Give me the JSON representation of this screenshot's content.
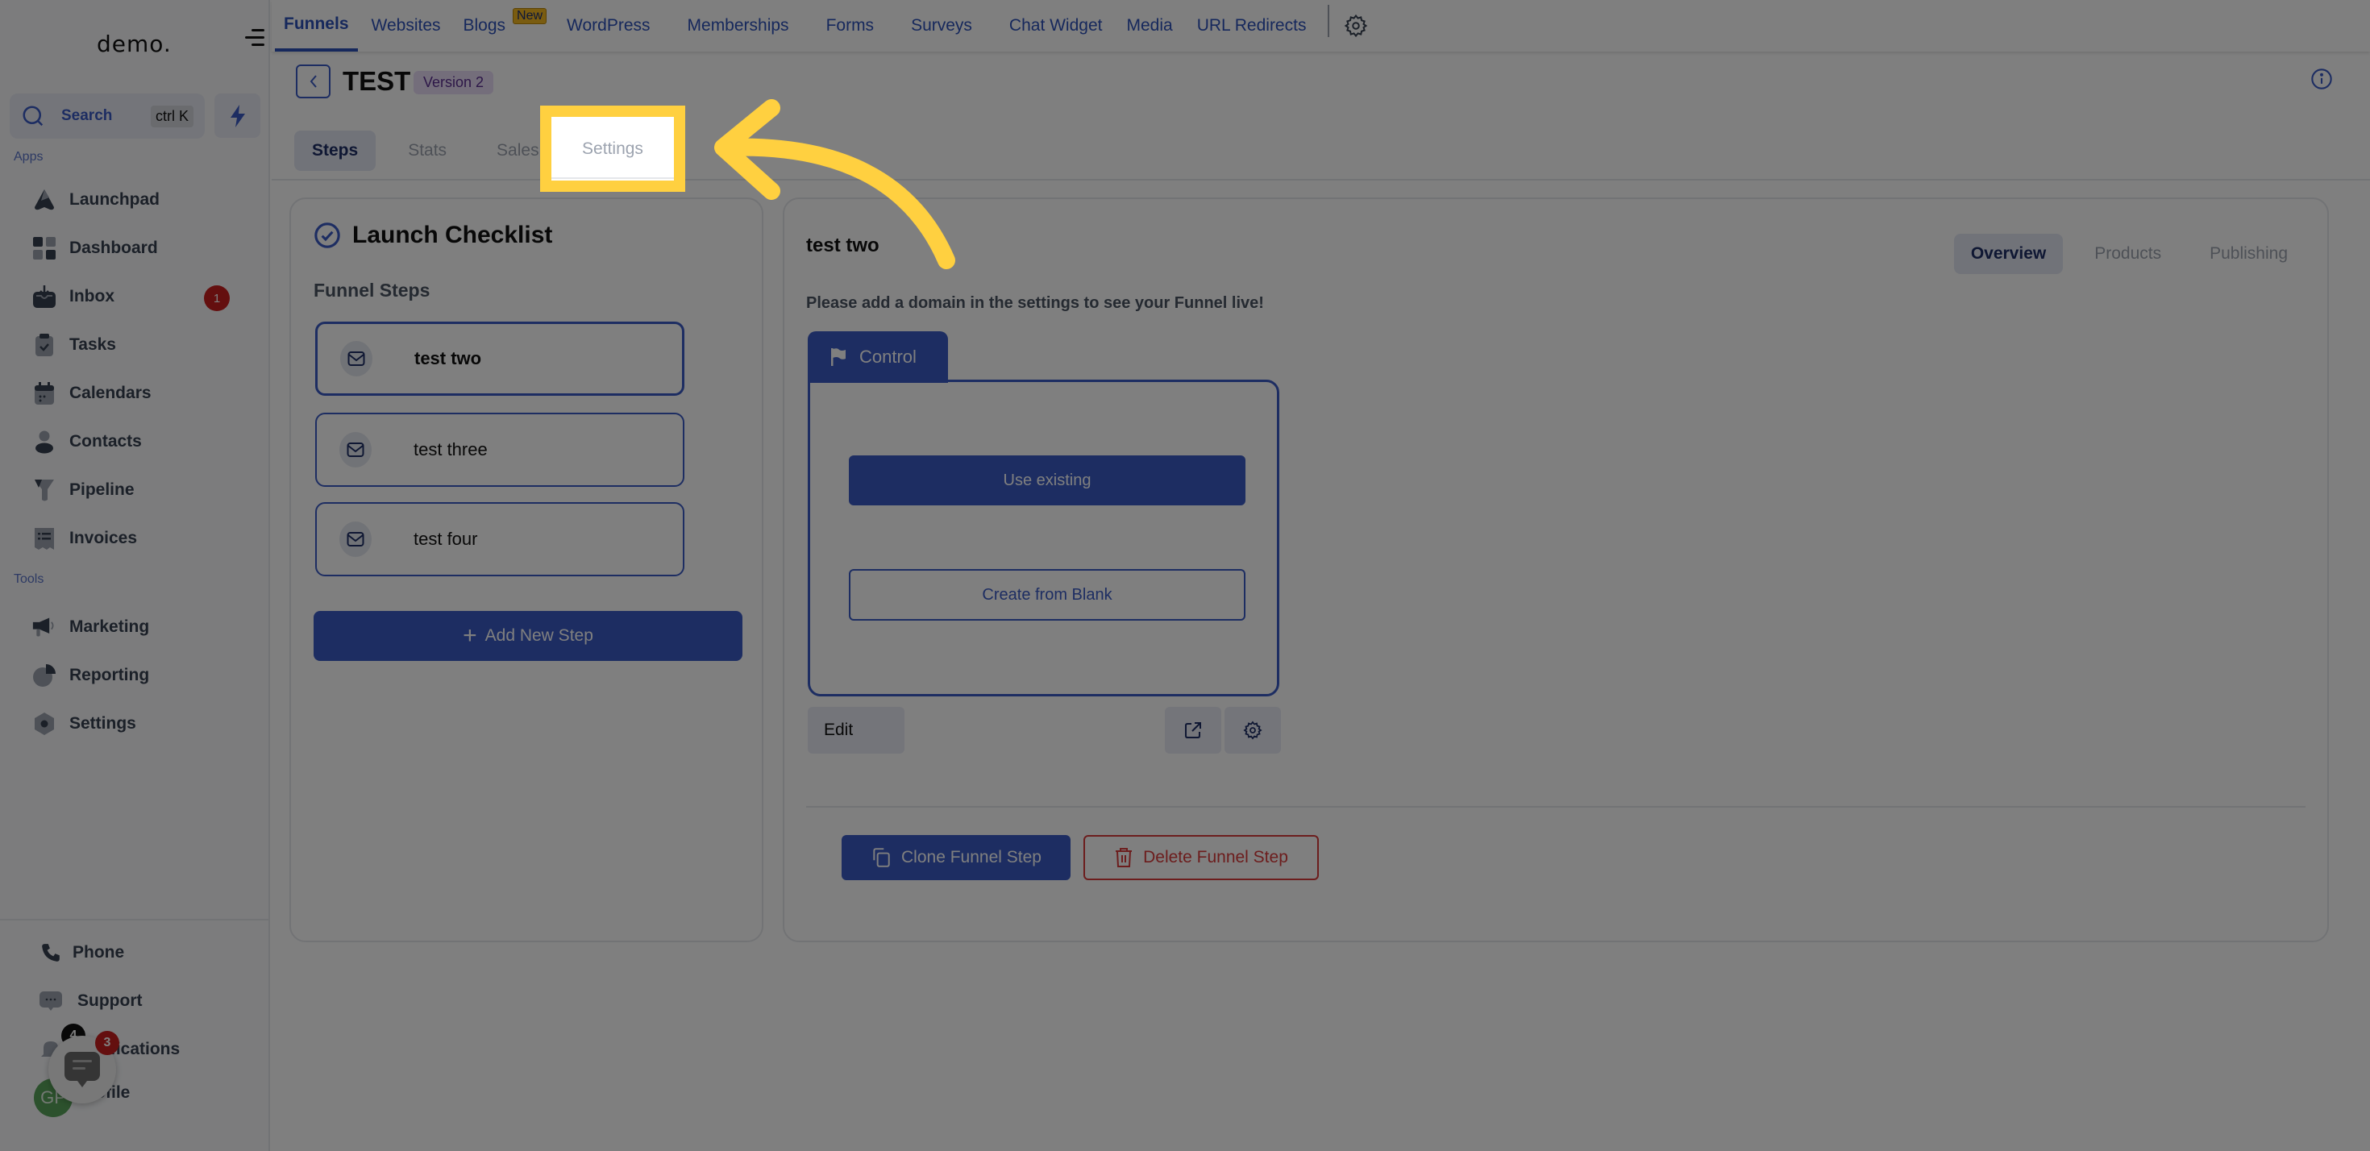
{
  "sidebar": {
    "logo": "demo.",
    "search": {
      "label": "Search",
      "shortcut": "ctrl K"
    },
    "sections": {
      "apps": "Apps",
      "tools": "Tools"
    },
    "apps_items": [
      {
        "label": "Launchpad",
        "icon": "launchpad-icon"
      },
      {
        "label": "Dashboard",
        "icon": "dashboard-icon"
      },
      {
        "label": "Inbox",
        "icon": "inbox-icon",
        "badge": "1"
      },
      {
        "label": "Tasks",
        "icon": "tasks-icon"
      },
      {
        "label": "Calendars",
        "icon": "calendar-icon"
      },
      {
        "label": "Contacts",
        "icon": "contacts-icon"
      },
      {
        "label": "Pipeline",
        "icon": "pipeline-icon"
      },
      {
        "label": "Invoices",
        "icon": "invoices-icon"
      }
    ],
    "tools_items": [
      {
        "label": "Marketing",
        "icon": "megaphone-icon"
      },
      {
        "label": "Reporting",
        "icon": "reporting-icon"
      },
      {
        "label": "Settings",
        "icon": "settings-icon"
      }
    ],
    "bottom_items": [
      {
        "label": "Phone",
        "icon": "phone-icon"
      },
      {
        "label": "Support",
        "icon": "support-icon"
      },
      {
        "label": "Notifications",
        "icon": "bell-icon",
        "badge": "4"
      },
      {
        "label": "Profile",
        "icon": "avatar"
      }
    ],
    "avatar_initials": "GP",
    "chat_widget_badge": "3"
  },
  "topnav": {
    "tabs": [
      {
        "label": "Funnels",
        "active": true
      },
      {
        "label": "Websites"
      },
      {
        "label": "Blogs",
        "badge": "New"
      },
      {
        "label": "WordPress"
      },
      {
        "label": "Memberships"
      },
      {
        "label": "Forms"
      },
      {
        "label": "Surveys"
      },
      {
        "label": "Chat Widget"
      },
      {
        "label": "Media"
      },
      {
        "label": "URL Redirects"
      }
    ]
  },
  "header": {
    "title": "TEST",
    "version": "Version 2",
    "tabs": [
      {
        "label": "Steps",
        "active": true
      },
      {
        "label": "Stats"
      },
      {
        "label": "Sales"
      },
      {
        "label": "Settings",
        "highlighted": true
      }
    ]
  },
  "left_panel": {
    "title": "Launch Checklist",
    "steps_label": "Funnel Steps",
    "steps": [
      {
        "name": "test two",
        "selected": true
      },
      {
        "name": "test three"
      },
      {
        "name": "test four"
      }
    ],
    "add_step_label": "Add New Step"
  },
  "right_panel": {
    "step_title": "test two",
    "tabs": [
      {
        "label": "Overview",
        "active": true
      },
      {
        "label": "Products"
      },
      {
        "label": "Publishing"
      }
    ],
    "domain_message": "Please add a domain in the settings to see your Funnel live!",
    "variant_tab": "Control",
    "use_existing_label": "Use existing",
    "create_blank_label": "Create from Blank",
    "edit_label": "Edit",
    "clone_label": "Clone Funnel Step",
    "delete_label": "Delete Funnel Step"
  },
  "colors": {
    "primary": "#3b5bc4",
    "danger": "#d93a3a",
    "highlight": "#ffd040",
    "badge_red": "#c81e1e"
  }
}
